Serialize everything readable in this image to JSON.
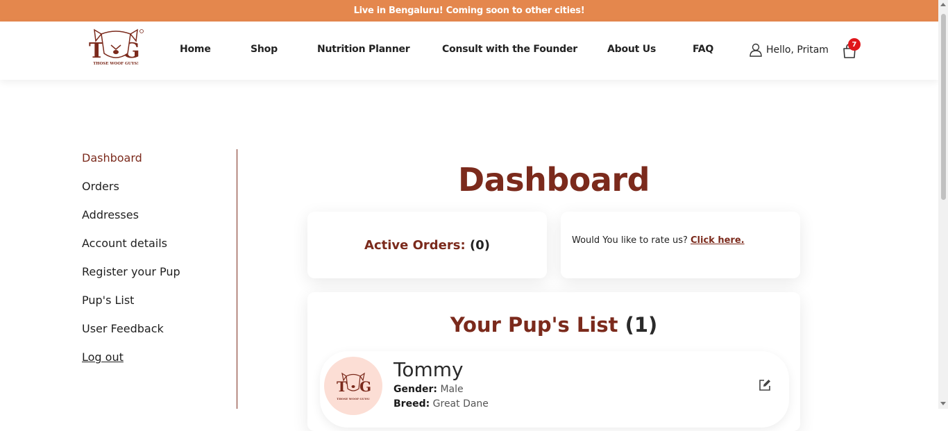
{
  "announcement": "Live in Bengaluru! Coming soon to other cities!",
  "brand": {
    "logo_letters": "TG",
    "tagline": "THOSE WOOF GUYS!"
  },
  "nav": {
    "home": "Home",
    "shop": "Shop",
    "nutrition": "Nutrition Planner",
    "consult": "Consult with the Founder",
    "about": "About Us",
    "faq": "FAQ"
  },
  "user": {
    "greeting": "Hello, Pritam",
    "cart_count": "7"
  },
  "sidebar": {
    "items": [
      {
        "label": "Dashboard"
      },
      {
        "label": "Orders"
      },
      {
        "label": "Addresses"
      },
      {
        "label": "Account details"
      },
      {
        "label": "Register your Pup"
      },
      {
        "label": "Pup's List"
      },
      {
        "label": "User Feedback"
      },
      {
        "label": "Log out"
      }
    ]
  },
  "main": {
    "title": "Dashboard",
    "active_orders_label": "Active Orders:",
    "active_orders_count": "(0)",
    "rate_text": "Would You like to rate us?",
    "rate_link": "Click here.",
    "pups_title": "Your Pup's List",
    "pups_count": "(1)",
    "pup": {
      "name": "Tommy",
      "gender_label": "Gender:",
      "gender": "Male",
      "breed_label": "Breed:",
      "breed": "Great Dane"
    }
  },
  "colors": {
    "accent": "#7b2a1c",
    "banner": "#e4874d",
    "badge": "#e0161b",
    "avatar_bg": "#fcded5"
  }
}
